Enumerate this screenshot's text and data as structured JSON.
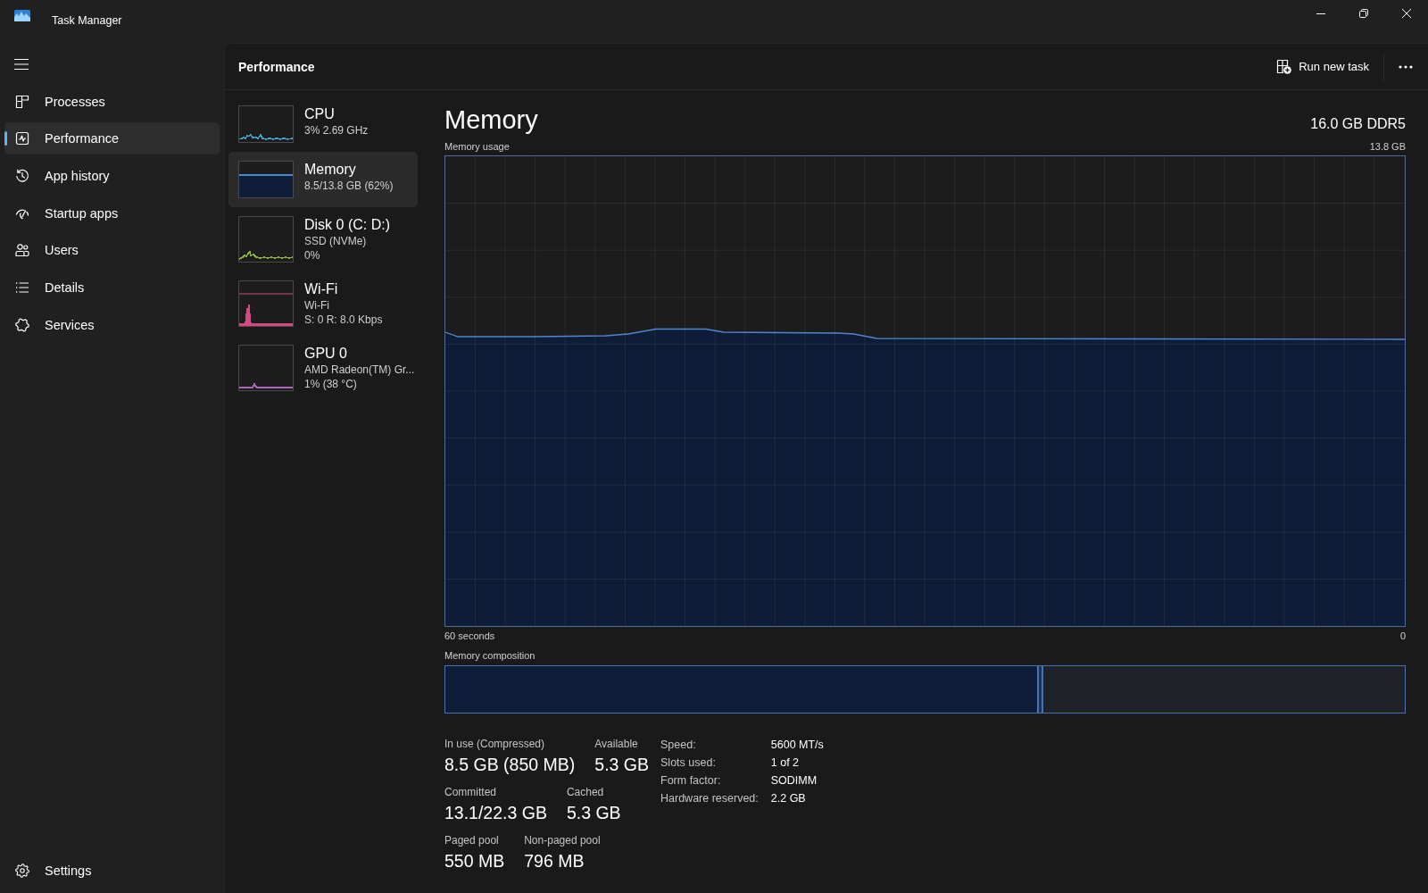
{
  "window": {
    "title": "Task Manager"
  },
  "sidebar": {
    "items": [
      {
        "label": "Processes",
        "selected": false
      },
      {
        "label": "Performance",
        "selected": true
      },
      {
        "label": "App history",
        "selected": false
      },
      {
        "label": "Startup apps",
        "selected": false
      },
      {
        "label": "Users",
        "selected": false
      },
      {
        "label": "Details",
        "selected": false
      },
      {
        "label": "Services",
        "selected": false
      }
    ],
    "footer_items": [
      {
        "label": "Settings",
        "selected": false
      }
    ]
  },
  "header": {
    "title": "Performance",
    "actions": [
      {
        "label": "Run new task"
      }
    ]
  },
  "devices": [
    {
      "kind": "cpu",
      "name": "CPU",
      "details": [
        "3% 2.69 GHz"
      ],
      "color": "#3ea6d0",
      "selected": false
    },
    {
      "kind": "memory",
      "name": "Memory",
      "details": [
        "8.5/13.8 GB (62%)"
      ],
      "color": "#4f86d0",
      "selected": true
    },
    {
      "kind": "disk",
      "name": "Disk 0 (C: D:)",
      "details": [
        "SSD (NVMe)",
        "0%"
      ],
      "color": "#8cb33a",
      "selected": false
    },
    {
      "kind": "network",
      "name": "Wi-Fi",
      "details": [
        "Wi-Fi",
        "S: 0 R: 8.0 Kbps"
      ],
      "color": "#d14a82",
      "selected": false
    },
    {
      "kind": "gpu",
      "name": "GPU 0",
      "details": [
        "AMD Radeon(TM) Gr...",
        "1% (38 °C)"
      ],
      "color": "#b060c0",
      "selected": false
    }
  ],
  "memory": {
    "title": "Memory",
    "capacity": "16.0 GB DDR5",
    "usage_graph": {
      "label": "Memory usage",
      "max_label": "13.8 GB",
      "start_label": "60 seconds",
      "end_label": "0"
    },
    "composition": {
      "label": "Memory composition",
      "segments": [
        {
          "kind": "in_use",
          "level": 0.617
        },
        {
          "kind": "modified",
          "level": 0.005
        },
        {
          "kind": "standby",
          "level": 0.378
        }
      ]
    },
    "stats": [
      [
        {
          "label": "In use (Compressed)",
          "value": "8.5 GB (850 MB)"
        },
        {
          "label": "Available",
          "value": "5.3 GB"
        }
      ],
      [
        {
          "label": "Committed",
          "value": "13.1/22.3 GB"
        },
        {
          "label": "Cached",
          "value": "5.3 GB"
        }
      ],
      [
        {
          "label": "Paged pool",
          "value": "550 MB"
        },
        {
          "label": "Non-paged pool",
          "value": "796 MB"
        }
      ]
    ],
    "properties": [
      {
        "label": "Speed:",
        "value": "5600 MT/s"
      },
      {
        "label": "Slots used:",
        "value": "1 of 2"
      },
      {
        "label": "Form factor:",
        "value": "SODIMM"
      },
      {
        "label": "Hardware reserved:",
        "value": "2.2 GB"
      }
    ]
  }
}
